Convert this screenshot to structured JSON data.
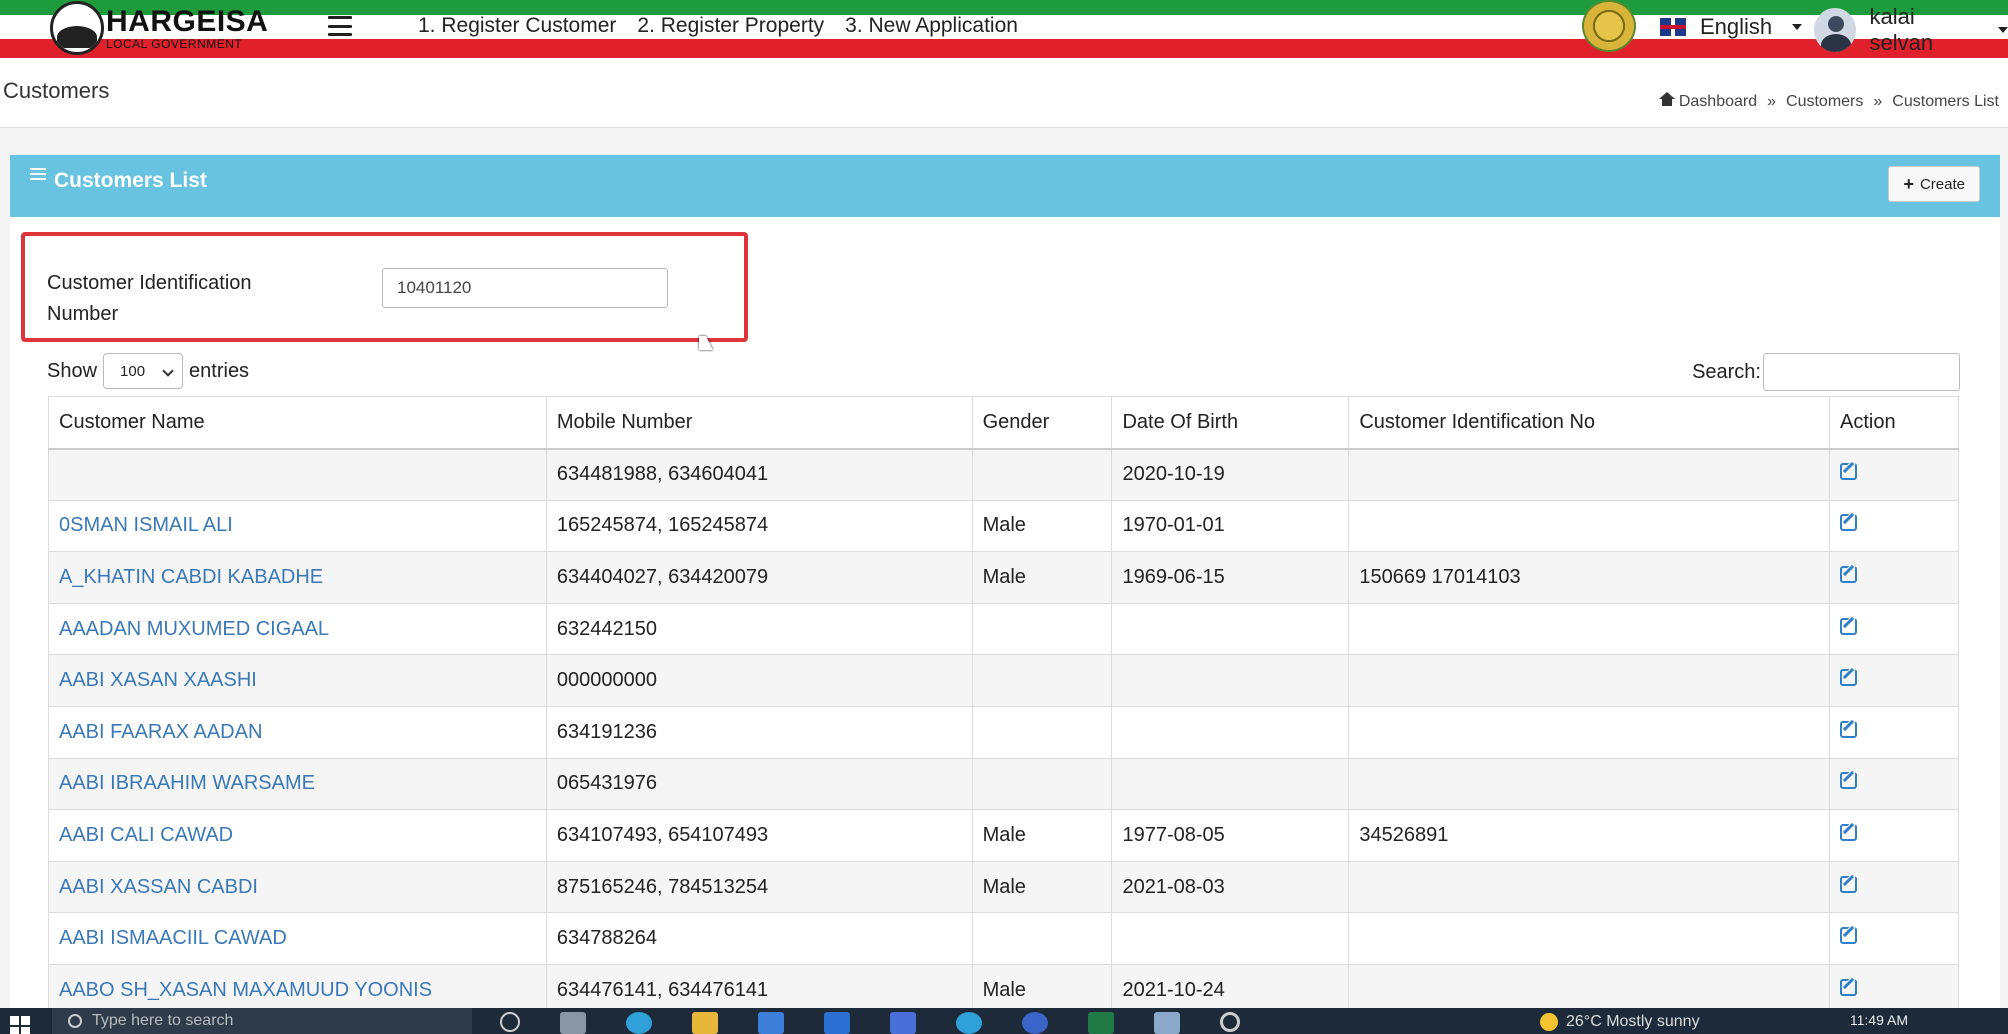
{
  "topbar": {
    "logo_main": "HARGEISA",
    "logo_sub": "LOCAL GOVERNMENT",
    "nav": [
      "1. Register Customer",
      "2. Register Property",
      "3. New Application"
    ],
    "language": "English",
    "user_name": "kalai selvan"
  },
  "page": {
    "title": "Customers",
    "breadcrumb": [
      "Dashboard",
      "Customers",
      "Customers List"
    ],
    "breadcrumb_sep": "»"
  },
  "panel": {
    "title": "Customers List",
    "create_label": "Create"
  },
  "filter": {
    "label": "Customer Identification Number",
    "value": "10401120"
  },
  "datatable": {
    "show_label": "Show",
    "entries_value": "100",
    "entries_label": "entries",
    "search_label": "Search:",
    "columns": [
      "Customer Name",
      "Mobile Number",
      "Gender",
      "Date Of Birth",
      "Customer Identification No",
      "Action"
    ],
    "rows": [
      [
        "",
        "634481988, 634604041",
        "",
        "2020-10-19",
        ""
      ],
      [
        "0SMAN ISMAIL ALI",
        "165245874, 165245874",
        "Male",
        "1970-01-01",
        ""
      ],
      [
        "A_KHATIN CABDI KABADHE",
        "634404027, 634420079",
        "Male",
        "1969-06-15",
        "150669 17014103"
      ],
      [
        "AAADAN MUXUMED CIGAAL",
        "632442150",
        "",
        "",
        ""
      ],
      [
        "AABI XASAN XAASHI",
        "000000000",
        "",
        "",
        ""
      ],
      [
        "AABI FAARAX AADAN",
        "634191236",
        "",
        "",
        ""
      ],
      [
        "AABI IBRAAHIM WARSAME",
        "065431976",
        "",
        "",
        ""
      ],
      [
        "AABI CALI CAWAD",
        "634107493, 654107493",
        "Male",
        "1977-08-05",
        "34526891"
      ],
      [
        "AABI XASSAN CABDI",
        "875165246, 784513254",
        "Male",
        "2021-08-03",
        ""
      ],
      [
        "AABI ISMAACIIL CAWAD",
        "634788264",
        "",
        "",
        ""
      ],
      [
        "AABO SH_XASAN MAXAMUUD YOONIS",
        "634476141, 634476141",
        "Male",
        "2021-10-24",
        ""
      ]
    ]
  },
  "taskbar": {
    "search_placeholder": "Type here to search",
    "weather": "26°C  Mostly sunny",
    "time": "11:49 AM"
  },
  "colors": {
    "panel_header": "#67c3e0",
    "link": "#3a78b8",
    "highlight_border": "#e0343b",
    "flag_green": "#1e9b3c",
    "flag_red": "#e0202a"
  }
}
